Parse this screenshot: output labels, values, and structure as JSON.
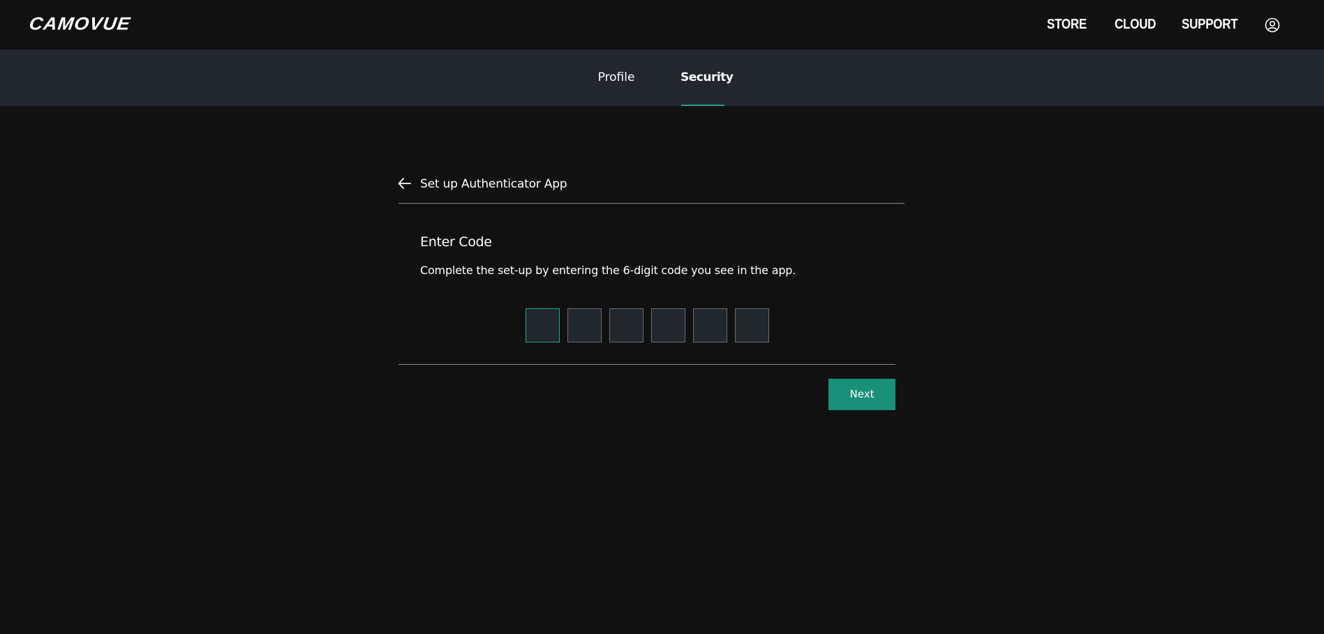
{
  "header": {
    "logo_text": "CAMOVUE",
    "nav": {
      "store": "STORE",
      "cloud": "CLOUD",
      "support": "SUPPORT"
    },
    "account_icon": "user-circle-icon"
  },
  "tabs": {
    "profile": "Profile",
    "security": "Security",
    "active": "Security"
  },
  "setup": {
    "back_icon": "arrow-left-icon",
    "title": "Set up Authenticator App",
    "section_title": "Enter Code",
    "description": "Complete the set-up by entering the 6-digit code you see in the app.",
    "code_digits": [
      "",
      "",
      "",
      "",
      "",
      ""
    ],
    "next_label": "Next"
  },
  "colors": {
    "background": "#111111",
    "tabbar": "#22262d",
    "accent": "#1aa58a",
    "button": "#1a8f7a",
    "logo_accent": "#e0262c"
  }
}
